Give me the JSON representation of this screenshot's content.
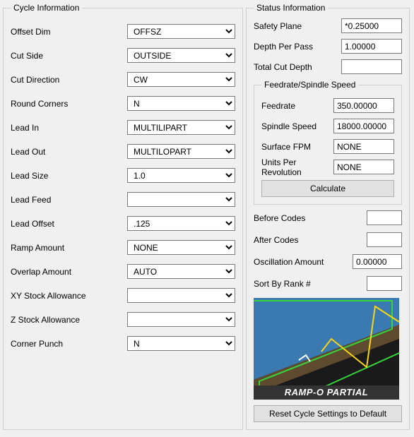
{
  "cycle": {
    "legend": "Cycle Information",
    "offset_dim": {
      "label": "Offset Dim",
      "value": "OFFSZ"
    },
    "cut_side": {
      "label": "Cut Side",
      "value": "OUTSIDE"
    },
    "cut_direction": {
      "label": "Cut Direction",
      "value": "CW"
    },
    "round_corners": {
      "label": "Round Corners",
      "value": "N"
    },
    "lead_in": {
      "label": "Lead In",
      "value": "MULTILIPART"
    },
    "lead_out": {
      "label": "Lead Out",
      "value": "MULTILOPART"
    },
    "lead_size": {
      "label": "Lead Size",
      "value": "1.0"
    },
    "lead_feed": {
      "label": "Lead Feed",
      "value": ""
    },
    "lead_offset": {
      "label": "Lead Offset",
      "value": ".125"
    },
    "ramp_amount": {
      "label": "Ramp Amount",
      "value": "NONE"
    },
    "overlap_amount": {
      "label": "Overlap Amount",
      "value": "AUTO"
    },
    "xy_stock": {
      "label": "XY Stock Allowance",
      "value": ""
    },
    "z_stock": {
      "label": "Z Stock Allowance",
      "value": ""
    },
    "corner_punch": {
      "label": "Corner Punch",
      "value": "N"
    }
  },
  "status": {
    "legend": "Status Information",
    "safety_plane": {
      "label": "Safety Plane",
      "value": "*0.25000"
    },
    "depth_per_pass": {
      "label": "Depth Per Pass",
      "value": "1.00000"
    },
    "total_cut_depth": {
      "label": "Total Cut Depth",
      "value": ""
    },
    "feedrate_group": {
      "legend": "Feedrate/Spindle Speed",
      "feedrate": {
        "label": "Feedrate",
        "value": "350.00000"
      },
      "spindle_speed": {
        "label": "Spindle Speed",
        "value": "18000.00000"
      },
      "surface_fpm": {
        "label": "Surface FPM",
        "value": "NONE"
      },
      "units_per_rev": {
        "label": "Units Per Revolution",
        "value": "NONE"
      },
      "calculate": "Calculate"
    },
    "before_codes": {
      "label": "Before Codes",
      "value": ""
    },
    "after_codes": {
      "label": "After Codes",
      "value": ""
    },
    "oscillation_amount": {
      "label": "Oscillation Amount",
      "value": "0.00000"
    },
    "sort_by_rank": {
      "label": "Sort By Rank #",
      "value": ""
    },
    "illustration_label": "RAMP-O PARTIAL",
    "reset": "Reset Cycle Settings to Default"
  },
  "colors": {
    "illus_blue": "#3a7ab0",
    "illus_brown": "#5e4a2f",
    "illus_green": "#37d43b",
    "illus_yellow": "#f5d516"
  }
}
